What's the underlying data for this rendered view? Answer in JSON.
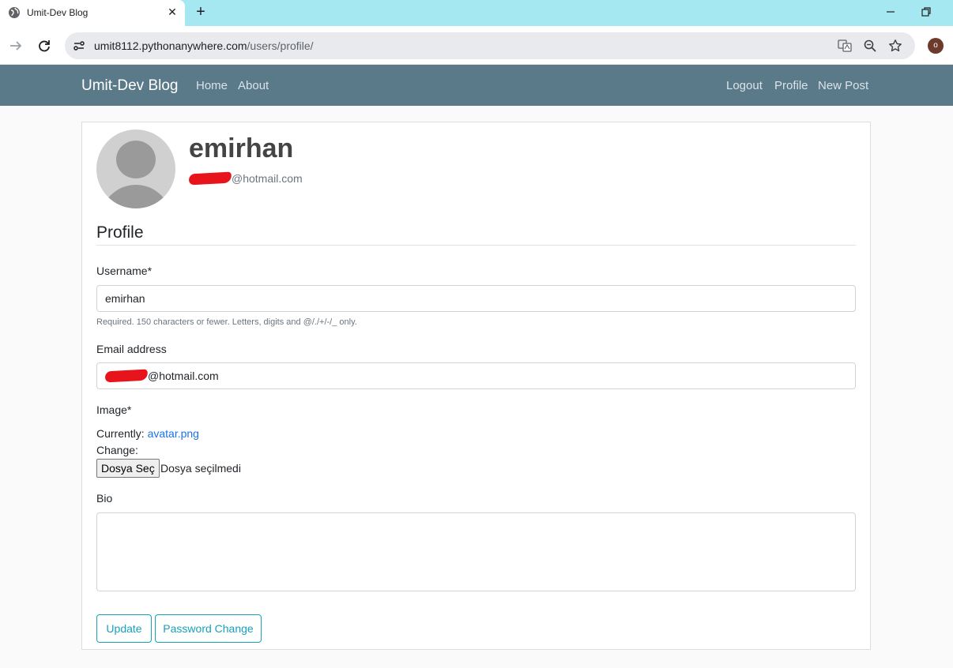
{
  "browser": {
    "tab_title": "Umit-Dev Blog",
    "tab_close": "✕",
    "new_tab": "+",
    "url_host": "umit8112.pythonanywhere.com",
    "url_path": "/users/profile/",
    "profile_initial": "o"
  },
  "navbar": {
    "brand": "Umit-Dev Blog",
    "left_links": [
      "Home",
      "About"
    ],
    "right_links": [
      "Logout",
      "Profile",
      "New Post"
    ]
  },
  "account": {
    "username": "emirhan",
    "email_suffix": "@hotmail.com"
  },
  "form": {
    "legend": "Profile",
    "username_label": "Username*",
    "username_value": "emirhan",
    "username_help": "Required. 150 characters or fewer. Letters, digits and @/./+/-/_ only.",
    "email_label": "Email address",
    "email_suffix": "@hotmail.com",
    "image_label": "Image*",
    "currently_label": "Currently:",
    "current_image": "avatar.png",
    "change_label": "Change:",
    "file_button": "Dosya Seç",
    "file_status": "Dosya seçilmedi",
    "bio_label": "Bio",
    "bio_value": "",
    "update_button": "Update",
    "password_change_button": "Password Change"
  },
  "colors": {
    "tab_strip": "#a6e8f2",
    "navbar": "#5a7989",
    "outline_button": "#17a2b8",
    "redaction": "#e8141b"
  }
}
